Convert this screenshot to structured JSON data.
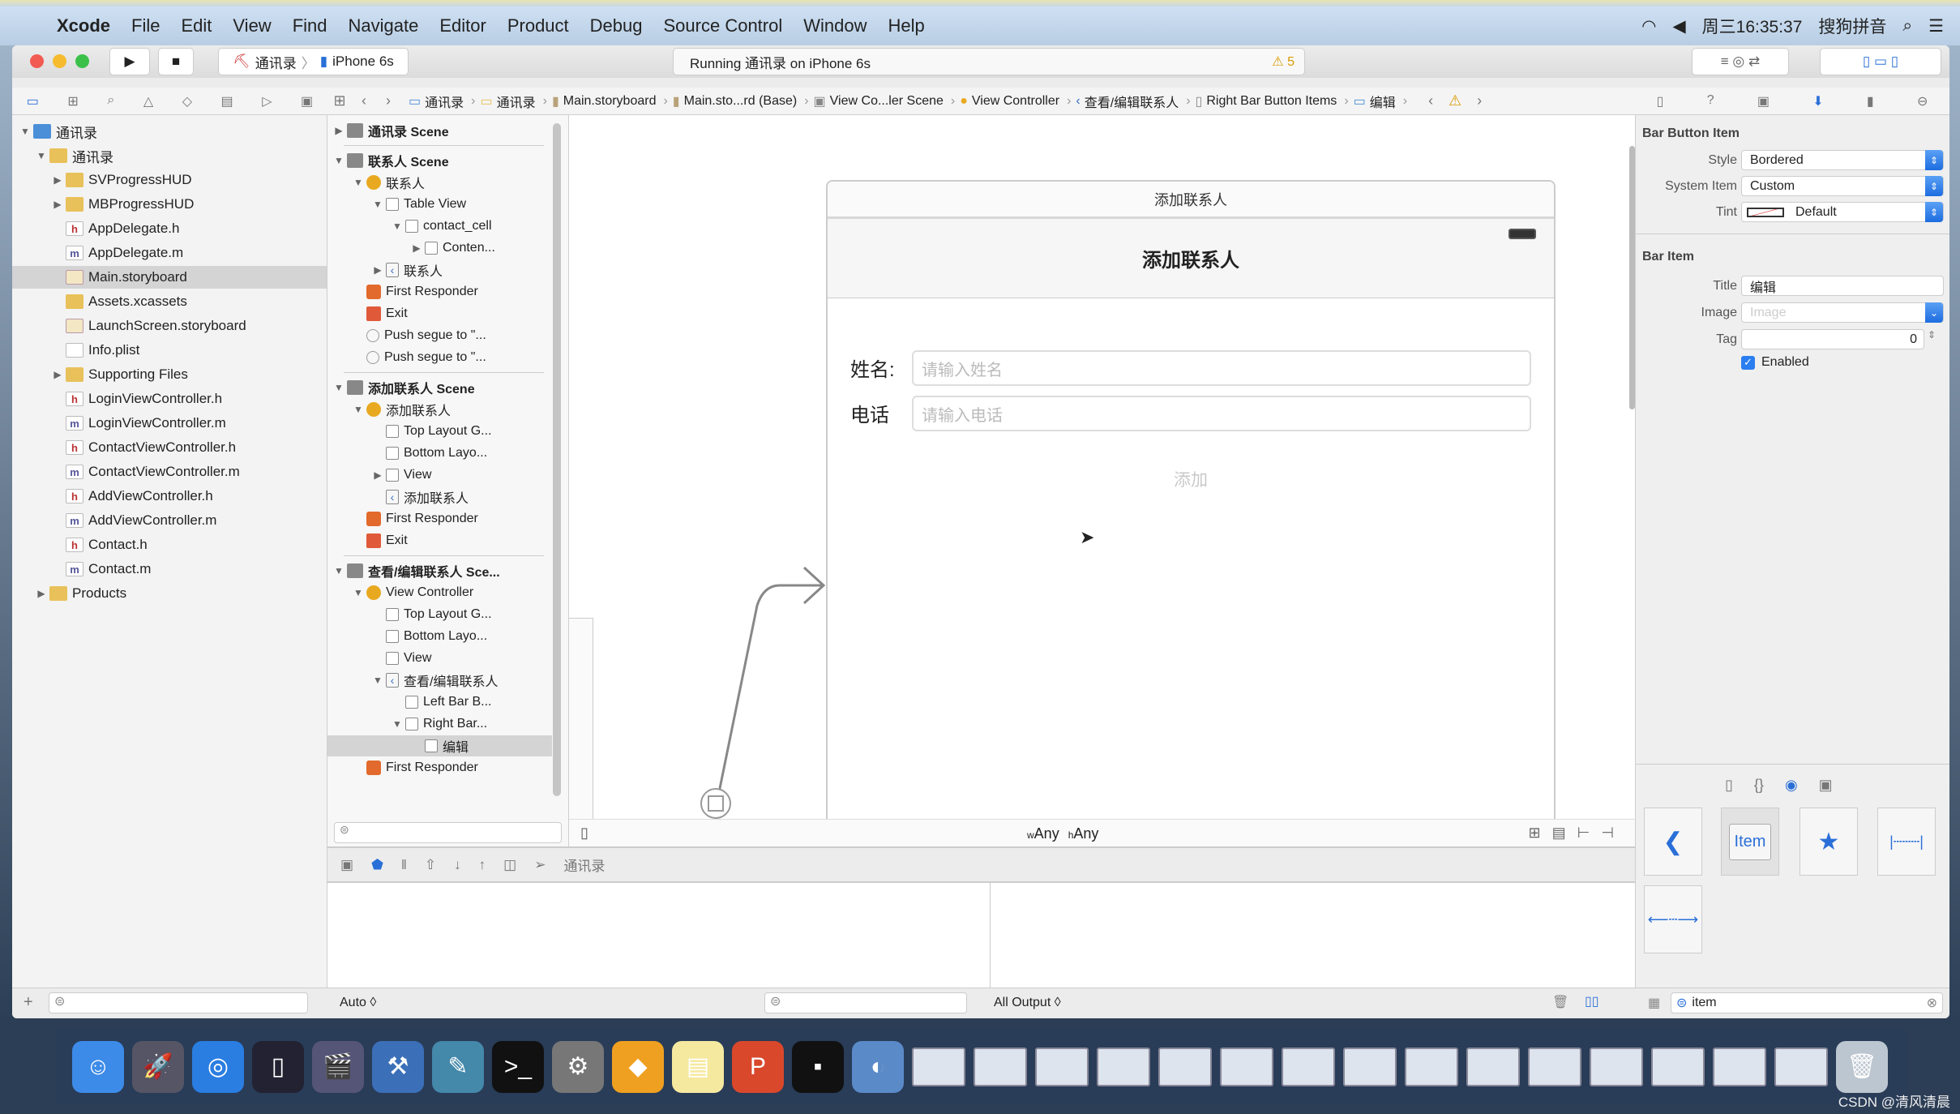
{
  "menubar": {
    "app": "Xcode",
    "items": [
      "File",
      "Edit",
      "View",
      "Find",
      "Navigate",
      "Editor",
      "Product",
      "Debug",
      "Source Control",
      "Window",
      "Help"
    ],
    "clock": "周三16:35:37",
    "ime": "搜狗拼音"
  },
  "toolbar": {
    "scheme": "通讯录",
    "device": "iPhone 6s",
    "activity": "Running 通讯录 on iPhone 6s",
    "warnings": "5"
  },
  "jumpbar": [
    "通讯录",
    "通讯录",
    "Main.storyboard",
    "Main.sto...rd (Base)",
    "View Co...ler Scene",
    "View Controller",
    "查看/编辑联系人",
    "Right Bar Button Items",
    "编辑"
  ],
  "navigator": [
    {
      "label": "通讯录",
      "level": 0,
      "icon": "proj",
      "open": true
    },
    {
      "label": "通讯录",
      "level": 1,
      "icon": "folder",
      "open": true
    },
    {
      "label": "SVProgressHUD",
      "level": 2,
      "icon": "folder",
      "open": false
    },
    {
      "label": "MBProgressHUD",
      "level": 2,
      "icon": "folder",
      "open": false
    },
    {
      "label": "AppDelegate.h",
      "level": 2,
      "icon": "h"
    },
    {
      "label": "AppDelegate.m",
      "level": 2,
      "icon": "m"
    },
    {
      "label": "Main.storyboard",
      "level": 2,
      "icon": "sb",
      "selected": true
    },
    {
      "label": "Assets.xcassets",
      "level": 2,
      "icon": "folder"
    },
    {
      "label": "LaunchScreen.storyboard",
      "level": 2,
      "icon": "sb"
    },
    {
      "label": "Info.plist",
      "level": 2,
      "icon": "plist"
    },
    {
      "label": "Supporting Files",
      "level": 2,
      "icon": "folder",
      "open": false
    },
    {
      "label": "LoginViewController.h",
      "level": 2,
      "icon": "h"
    },
    {
      "label": "LoginViewController.m",
      "level": 2,
      "icon": "m"
    },
    {
      "label": "ContactViewController.h",
      "level": 2,
      "icon": "h"
    },
    {
      "label": "ContactViewController.m",
      "level": 2,
      "icon": "m"
    },
    {
      "label": "AddViewController.h",
      "level": 2,
      "icon": "h"
    },
    {
      "label": "AddViewController.m",
      "level": 2,
      "icon": "m"
    },
    {
      "label": "Contact.h",
      "level": 2,
      "icon": "h"
    },
    {
      "label": "Contact.m",
      "level": 2,
      "icon": "m"
    },
    {
      "label": "Products",
      "level": 1,
      "icon": "folder",
      "open": false
    }
  ],
  "outline": [
    {
      "label": "通讯录 Scene",
      "level": 0,
      "icon": "scene",
      "open": false,
      "bold": true
    },
    {
      "sep": true
    },
    {
      "label": "联系人 Scene",
      "level": 0,
      "icon": "scene",
      "open": true,
      "bold": true
    },
    {
      "label": "联系人",
      "level": 1,
      "icon": "vc",
      "open": true
    },
    {
      "label": "Table View",
      "level": 2,
      "icon": "view",
      "open": true
    },
    {
      "label": "contact_cell",
      "level": 3,
      "icon": "view",
      "open": true
    },
    {
      "label": "Conten...",
      "level": 4,
      "icon": "view",
      "open": false
    },
    {
      "label": "联系人",
      "level": 2,
      "icon": "navitem",
      "open": false
    },
    {
      "label": "First Responder",
      "level": 1,
      "icon": "fr"
    },
    {
      "label": "Exit",
      "level": 1,
      "icon": "exit"
    },
    {
      "label": "Push segue to \"...",
      "level": 1,
      "icon": "segue"
    },
    {
      "label": "Push segue to \"...",
      "level": 1,
      "icon": "segue"
    },
    {
      "sep": true
    },
    {
      "label": "添加联系人 Scene",
      "level": 0,
      "icon": "scene",
      "open": true,
      "bold": true
    },
    {
      "label": "添加联系人",
      "level": 1,
      "icon": "vc",
      "open": true
    },
    {
      "label": "Top Layout G...",
      "level": 2,
      "icon": "view"
    },
    {
      "label": "Bottom Layo...",
      "level": 2,
      "icon": "view"
    },
    {
      "label": "View",
      "level": 2,
      "icon": "view",
      "open": false
    },
    {
      "label": "添加联系人",
      "level": 2,
      "icon": "navitem"
    },
    {
      "label": "First Responder",
      "level": 1,
      "icon": "fr"
    },
    {
      "label": "Exit",
      "level": 1,
      "icon": "exit"
    },
    {
      "sep": true
    },
    {
      "label": "查看/编辑联系人 Sce...",
      "level": 0,
      "icon": "scene",
      "open": true,
      "bold": true
    },
    {
      "label": "View Controller",
      "level": 1,
      "icon": "vc",
      "open": true
    },
    {
      "label": "Top Layout G...",
      "level": 2,
      "icon": "view"
    },
    {
      "label": "Bottom Layo...",
      "level": 2,
      "icon": "view"
    },
    {
      "label": "View",
      "level": 2,
      "icon": "view"
    },
    {
      "label": "查看/编辑联系人",
      "level": 2,
      "icon": "navitem",
      "open": true
    },
    {
      "label": "Left Bar B...",
      "level": 3,
      "icon": "view"
    },
    {
      "label": "Right Bar...",
      "level": 3,
      "icon": "view",
      "open": true
    },
    {
      "label": "编辑",
      "level": 4,
      "icon": "view",
      "selected": true
    },
    {
      "label": "First Responder",
      "level": 1,
      "icon": "fr"
    }
  ],
  "scene": {
    "title": "添加联系人",
    "nav_title": "添加联系人",
    "name_label": "姓名:",
    "name_placeholder": "请输入姓名",
    "phone_label": "电话",
    "phone_placeholder": "请输入电话",
    "add_button": "添加"
  },
  "canvas": {
    "w_prefix": "w",
    "w_value": "Any",
    "h_prefix": "h",
    "h_value": "Any"
  },
  "debug": {
    "target": "通讯录",
    "auto": "Auto ◊",
    "output": "All Output ◊"
  },
  "inspector": {
    "section1": "Bar Button Item",
    "style_label": "Style",
    "style": "Bordered",
    "system_item_label": "System Item",
    "system_item": "Custom",
    "tint_label": "Tint",
    "tint": "Default",
    "section2": "Bar Item",
    "title_label": "Title",
    "title": "编辑",
    "image_label": "Image",
    "image_placeholder": "Image",
    "tag_label": "Tag",
    "tag": "0",
    "enabled_label": "Enabled",
    "enabled": true,
    "library_item_label": "Item",
    "filter": "item"
  },
  "watermark": "CSDN @清风清晨"
}
